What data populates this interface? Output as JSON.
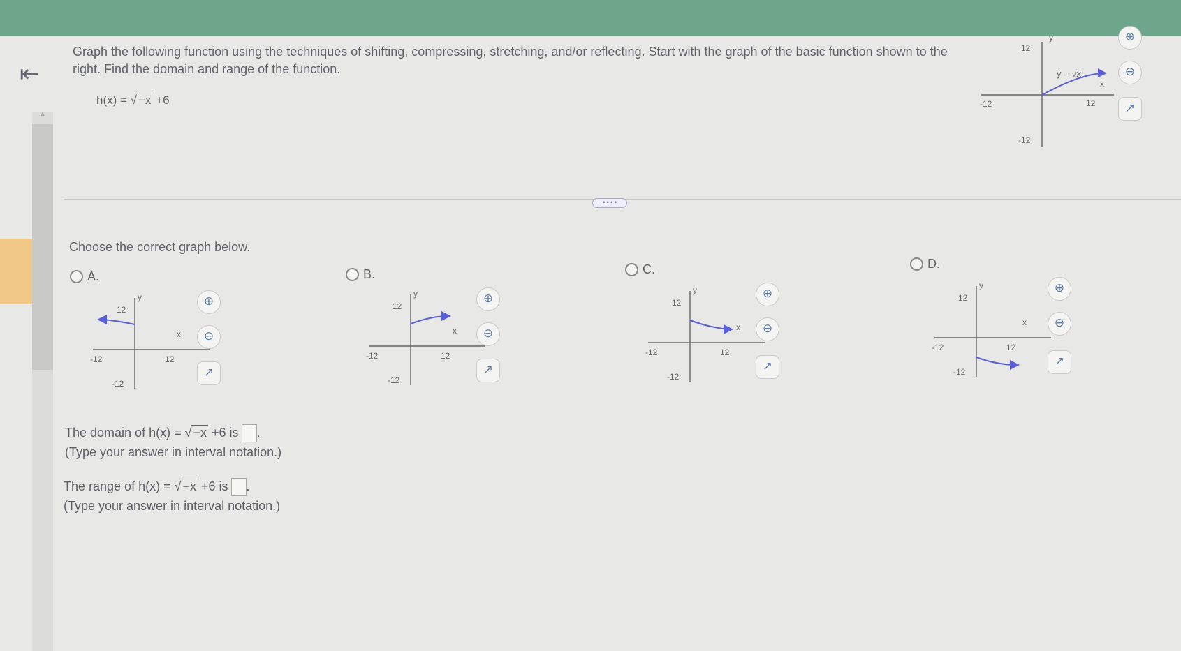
{
  "header": {
    "back_icon": "first-page-arrow-icon",
    "question_text": "Graph the following function using the techniques of shifting, compressing, stretching, and/or reflecting. Start with the graph of the basic function shown to the right. Find the domain and range of the function.",
    "function_prefix": "h(x) =",
    "function_radicand": "−x",
    "function_suffix": "+6"
  },
  "basic_graph": {
    "y_label": "y",
    "x_label": "x",
    "curve_label": "y = √x",
    "tick_12": "12",
    "tick_neg12": "-12"
  },
  "divider": {
    "handle_text": "• • • •"
  },
  "choose_text": "Choose the correct graph below.",
  "options": [
    {
      "letter": "A.",
      "x_label": "x",
      "y_label": "y",
      "tick_12": "12",
      "tick_neg12": "-12"
    },
    {
      "letter": "B.",
      "x_label": "x",
      "y_label": "y",
      "tick_12": "12",
      "tick_neg12": "-12"
    },
    {
      "letter": "C.",
      "x_label": "x",
      "y_label": "y",
      "tick_12": "12",
      "tick_neg12": "-12"
    },
    {
      "letter": "D.",
      "x_label": "x",
      "y_label": "y",
      "tick_12": "12",
      "tick_neg12": "-12"
    }
  ],
  "domain": {
    "prefix": "The domain of h(x) =",
    "radicand": "−x",
    "suffix": "+6 is",
    "hint": "(Type your answer in interval notation.)"
  },
  "range": {
    "prefix": "The range of h(x) =",
    "radicand": "−x",
    "suffix": "+6 is",
    "hint": "(Type your answer in interval notation.)"
  },
  "tools": {
    "zoom_in_icon": "zoom-in-icon",
    "zoom_out_icon": "zoom-out-icon",
    "popout_icon": "popout-icon"
  },
  "colors": {
    "header_bar": "#6ea68c",
    "curve": "#5b5fd6",
    "tool_icon": "#5d7ea8",
    "orange_tab": "#f2c889"
  }
}
